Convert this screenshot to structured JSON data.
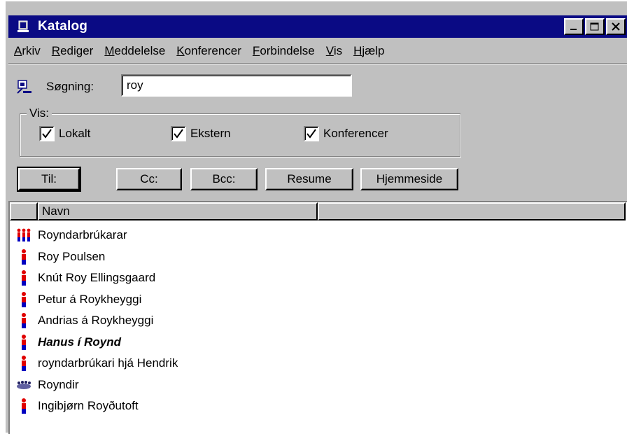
{
  "window": {
    "title": "Katalog"
  },
  "menubar": {
    "items": [
      {
        "u": "A",
        "rest": "rkiv"
      },
      {
        "u": "R",
        "rest": "ediger"
      },
      {
        "u": "M",
        "rest": "eddelelse"
      },
      {
        "u": "K",
        "rest": "onferencer"
      },
      {
        "u": "F",
        "rest": "orbindelse"
      },
      {
        "u": "V",
        "rest": "is"
      },
      {
        "u": "H",
        "rest": "jælp"
      }
    ]
  },
  "search": {
    "label": "Søgning:",
    "value": "roy"
  },
  "vis": {
    "label": "Vis:",
    "options": [
      {
        "label": "Lokalt",
        "checked": true
      },
      {
        "label": "Ekstern",
        "checked": true
      },
      {
        "label": "Konferencer",
        "checked": true
      }
    ]
  },
  "buttons": {
    "til": "Til:",
    "cc": "Cc:",
    "bcc": "Bcc:",
    "resume": "Resume",
    "hjemmeside": "Hjemmeside"
  },
  "list": {
    "column": "Navn",
    "rows": [
      {
        "name": "Royndarbrúkarar",
        "icon": "group-icon"
      },
      {
        "name": "Roy Poulsen",
        "icon": "person-icon"
      },
      {
        "name": "Knút Roy Ellingsgaard",
        "icon": "person-icon"
      },
      {
        "name": "Petur á Roykheyggi",
        "icon": "person-icon"
      },
      {
        "name": "Andrias á Roykheyggi",
        "icon": "person-icon"
      },
      {
        "name": "Hanus í Roynd",
        "icon": "person-icon",
        "bold": true
      },
      {
        "name": "royndarbrúkari hjá Hendrik",
        "icon": "person-icon"
      },
      {
        "name": "Royndir",
        "icon": "conference-icon"
      },
      {
        "name": "Ingibjørn Royðutoft",
        "icon": "person-icon"
      }
    ]
  },
  "colors": {
    "titlebar": "#0a0a84",
    "face": "#c0c0c0",
    "person_red": "#e00000",
    "person_blue": "#0000c0"
  }
}
